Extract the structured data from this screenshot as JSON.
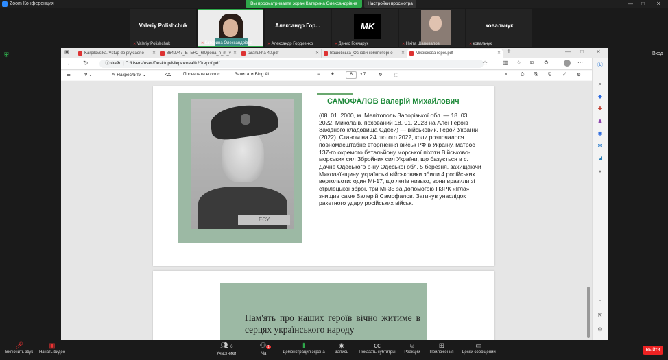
{
  "zoom": {
    "app_title": "Zoom Конференция",
    "share_banner": "Вы просматриваете экран Катерина Олександрівна",
    "view_settings": "Настройки просмотра",
    "enter_label": "Вход",
    "participants": [
      {
        "big": "Valeriy Polishchuk",
        "small": "Valeriy Polishchuk"
      },
      {
        "big": "",
        "small": "Катерина Олександрівна"
      },
      {
        "big": "Александр   Гор...",
        "small": "Александр Гордиенко"
      },
      {
        "big": "MK",
        "small": "Денис Гончарук"
      },
      {
        "big": "",
        "small": "Нікіта Шаповалов"
      },
      {
        "big": "ковальчук",
        "small": "ковальчук"
      }
    ],
    "toolbar": {
      "audio": "Включить звук",
      "video": "Начать видео",
      "participants_count": "6",
      "participants": "Участники",
      "chat_badge": "1",
      "chat": "Чат",
      "share": "Демонстрация экрана",
      "record": "Запись",
      "captions": "Показать субтитры",
      "reactions": "Реакции",
      "apps": "Приложения",
      "whiteboard": "Доски сообщений",
      "exit": "Выйти"
    }
  },
  "browser": {
    "tabs": [
      {
        "label": "Karpilovs'ka. Vstup do prykladno"
      },
      {
        "label": "8642747_ETEFC_6Юрона_n_m_v"
      },
      {
        "label": "taranukha-40.pdf"
      },
      {
        "label": "Вашовська_Основи комп'ютерно"
      },
      {
        "label": "Мікрюкова герої.pdf"
      }
    ],
    "new_tab": "+",
    "url_prefix": "Файл",
    "url": "C:/Users/user/Desktop/Мікрюкова%20герої.pdf",
    "pdf_toolbar": {
      "draw": "Накреслити",
      "read_aloud": "Прочитати вголос",
      "ask_bing": "Запитати Bing AI",
      "minus": "−",
      "plus": "+",
      "page_current": "6",
      "page_total": "з 7"
    }
  },
  "pdf": {
    "bio_title": "САМОФА́ЛОВ Валерій Михайлович",
    "bio_text": "(08. 01. 2000, м. Мелітополь Запорізької обл. — 18. 03. 2022, Миколаїв, похований 18. 01. 2023 на Алеї Героїв Західного кладовища Одеси) — військовик. Герой України (2022). Станом на 24 лютого 2022, коли розпочалося повномасштабне вторгнення військ РФ в Україну, матрос 137-го окремого батальйону морської піхоти Військово-морських сил Збройних сил України, що базується в с. Дачне Одеського р-ну Одеської обл. 5 березня, захищаючи Миколаївщину, українські військовики збили 4 російських вертольоти: один Мі-17, що летів низько, вони вразили зі стрілецької зброї, три Мі-35 за допомогою ПЗРК «Ігла» знищив саме Валерій Самофалов. Загинув унаслідок ракетного удару російських військ.",
    "photo_caption": "ЕСУ",
    "memory_text": "Пам'ять про наших героїв вічно житиме в серцях українського народу"
  }
}
